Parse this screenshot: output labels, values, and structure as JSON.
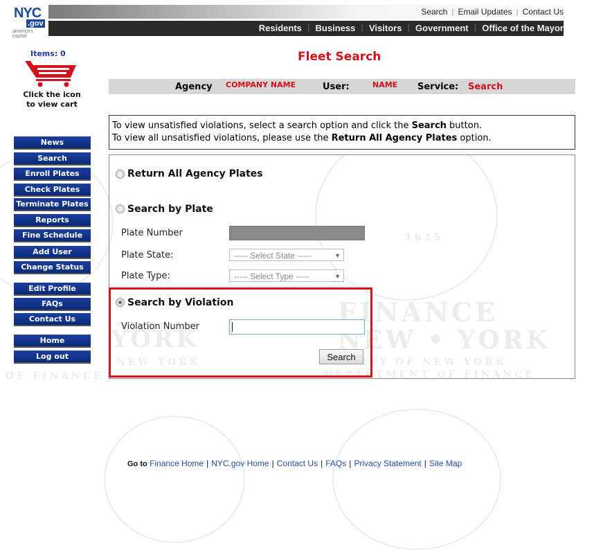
{
  "header": {
    "logo": {
      "nyc": "NYC",
      "gov": ".gov",
      "tagline": "america's capital"
    },
    "top_links": [
      "Search",
      "Email Updates",
      "Contact Us"
    ],
    "nav_links": [
      "Residents",
      "Business",
      "Visitors",
      "Government",
      "Office of the Mayor"
    ]
  },
  "cart": {
    "items_label": "Items: 0",
    "caption_line1": "Click the icon",
    "caption_line2": "to view cart"
  },
  "sidebar": {
    "items": [
      {
        "label": "News"
      },
      {
        "label": "Search"
      },
      {
        "label": "Enroll Plates"
      },
      {
        "label": "Check Plates"
      },
      {
        "label": "Terminate Plates"
      },
      {
        "label": "Reports"
      },
      {
        "label": "Fine Schedule"
      },
      {
        "label": "Add User"
      },
      {
        "label": "Change Status"
      },
      {
        "label": "Edit Profile"
      },
      {
        "label": "FAQs"
      },
      {
        "label": "Contact Us"
      },
      {
        "label": "Home"
      },
      {
        "label": "Log out"
      }
    ]
  },
  "page_title": "Fleet Search",
  "info_bar": {
    "agency_label": "Agency",
    "agency_value": "COMPANY NAME",
    "user_label": "User:",
    "user_value": "NAME",
    "service_label": "Service:",
    "service_value": "Search"
  },
  "instructions": {
    "line1_pre": "To view unsatisfied violations, select a search option and click the ",
    "line1_bold": "Search",
    "line1_post": " button.",
    "line2_pre": "To view all unsatisfied violations, please use the ",
    "line2_bold": "Return All Agency Plates",
    "line2_post": " option."
  },
  "search_options": {
    "return_all": {
      "label": "Return All Agency Plates",
      "selected": false
    },
    "by_plate": {
      "label": "Search by Plate",
      "selected": false,
      "plate_number_label": "Plate Number",
      "plate_number_value": "",
      "plate_state_label": "Plate State:",
      "plate_state_value": "----- Select State -----",
      "plate_type_label": "Plate Type:",
      "plate_type_value": "----- Select Type -----"
    },
    "by_violation": {
      "label": "Search by Violation",
      "selected": true,
      "violation_number_label": "Violation Number",
      "violation_number_value": ""
    },
    "search_button": "Search"
  },
  "watermark": {
    "finance": "FINANCE",
    "new_york": "NEW • YORK",
    "city_of_new_york": "CITY OF NEW YORK",
    "department_of_finance": "DEPARTMENT OF FINANCE",
    "york": "YORK",
    "new_york_small": "NEW YORK",
    "of_finance": "OF FINANCE",
    "year": "1625"
  },
  "footer": {
    "go_to": "Go to",
    "links": [
      "Finance Home",
      "NYC.gov Home",
      "Contact Us",
      "FAQs",
      "Privacy Statement",
      "Site Map"
    ]
  },
  "colors": {
    "accent_red": "#d4101a",
    "menu_blue": "#0b2a78",
    "link_blue": "#1f4ea8"
  }
}
